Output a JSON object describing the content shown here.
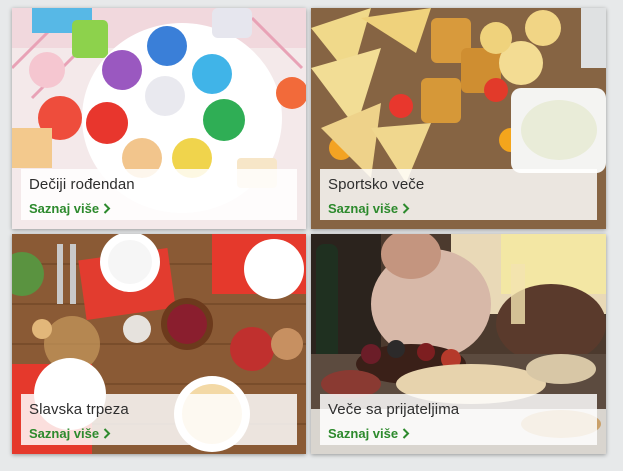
{
  "cards": [
    {
      "title": "Dečiji rođendan",
      "cta_label": "Saznaj više",
      "image": "birthday-cupcakes-photo"
    },
    {
      "title": "Sportsko veče",
      "cta_label": "Saznaj više",
      "image": "snacks-chips-pretzels-photo"
    },
    {
      "title": "Slavska trpeza",
      "cta_label": "Saznaj više",
      "image": "festive-table-photo"
    },
    {
      "title": "Veče sa prijateljima",
      "cta_label": "Saznaj više",
      "image": "friends-dinner-photo"
    }
  ],
  "colors": {
    "cta": "#2d8a2d",
    "title": "#2e2e2e",
    "caption_bg": "rgba(255,255,255,0.84)"
  }
}
